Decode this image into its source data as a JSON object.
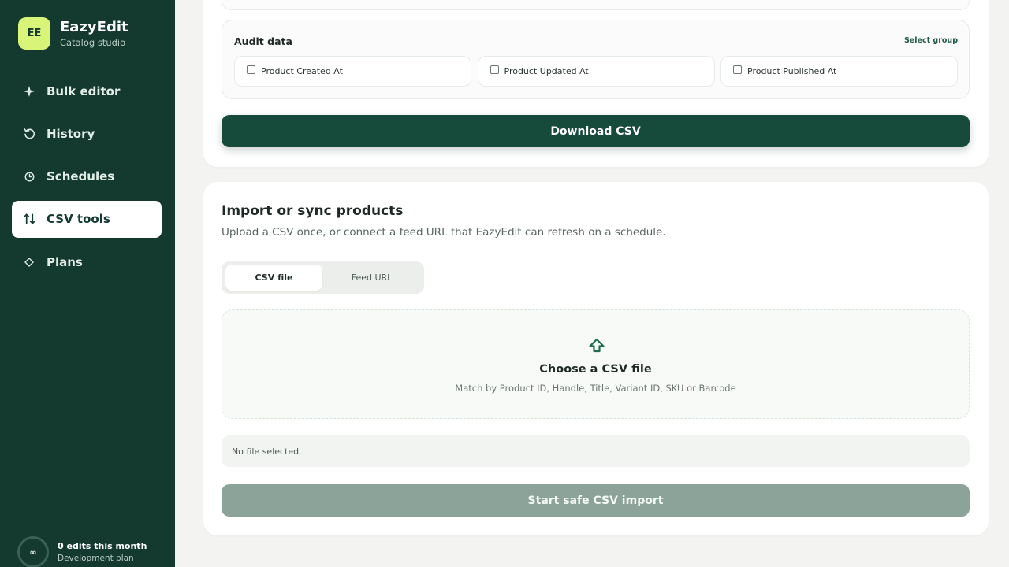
{
  "brand": {
    "logo_text": "EE",
    "name": "EazyEdit",
    "subtitle": "Catalog studio"
  },
  "sidebar": {
    "items": [
      {
        "label": "Bulk editor",
        "icon": "sparkle-icon",
        "active": false
      },
      {
        "label": "History",
        "icon": "history-icon",
        "active": false
      },
      {
        "label": "Schedules",
        "icon": "clock-icon",
        "active": false
      },
      {
        "label": "CSV tools",
        "icon": "swap-arrows-icon",
        "active": true
      },
      {
        "label": "Plans",
        "icon": "diamond-icon",
        "active": false
      }
    ],
    "usage": {
      "ring_text": "∞",
      "title": "0 edits this month",
      "subtitle": "Development plan"
    }
  },
  "export": {
    "audit_group": {
      "title": "Audit data",
      "select_group_label": "Select group",
      "fields": [
        {
          "label": "Product Created At",
          "checked": false
        },
        {
          "label": "Product Updated At",
          "checked": false
        },
        {
          "label": "Product Published At",
          "checked": false
        }
      ]
    },
    "download_label": "Download CSV"
  },
  "import": {
    "title": "Import or sync products",
    "subtitle": "Upload a CSV once, or connect a feed URL that EazyEdit can refresh on a schedule.",
    "tabs": [
      {
        "label": "CSV file",
        "selected": true
      },
      {
        "label": "Feed URL",
        "selected": false
      }
    ],
    "dropzone": {
      "icon": "upload-arrow-icon",
      "title": "Choose a CSV file",
      "hint": "Match by Product ID, Handle, Title, Variant ID, SKU or Barcode"
    },
    "file_status": "No file selected.",
    "start_label": "Start safe CSV import"
  },
  "colors": {
    "sidebar_bg": "#14392f",
    "accent_lime": "#d8f57a",
    "primary_button": "#164a3b",
    "disabled_button": "#8ba398",
    "page_bg": "#f3f4f1"
  }
}
